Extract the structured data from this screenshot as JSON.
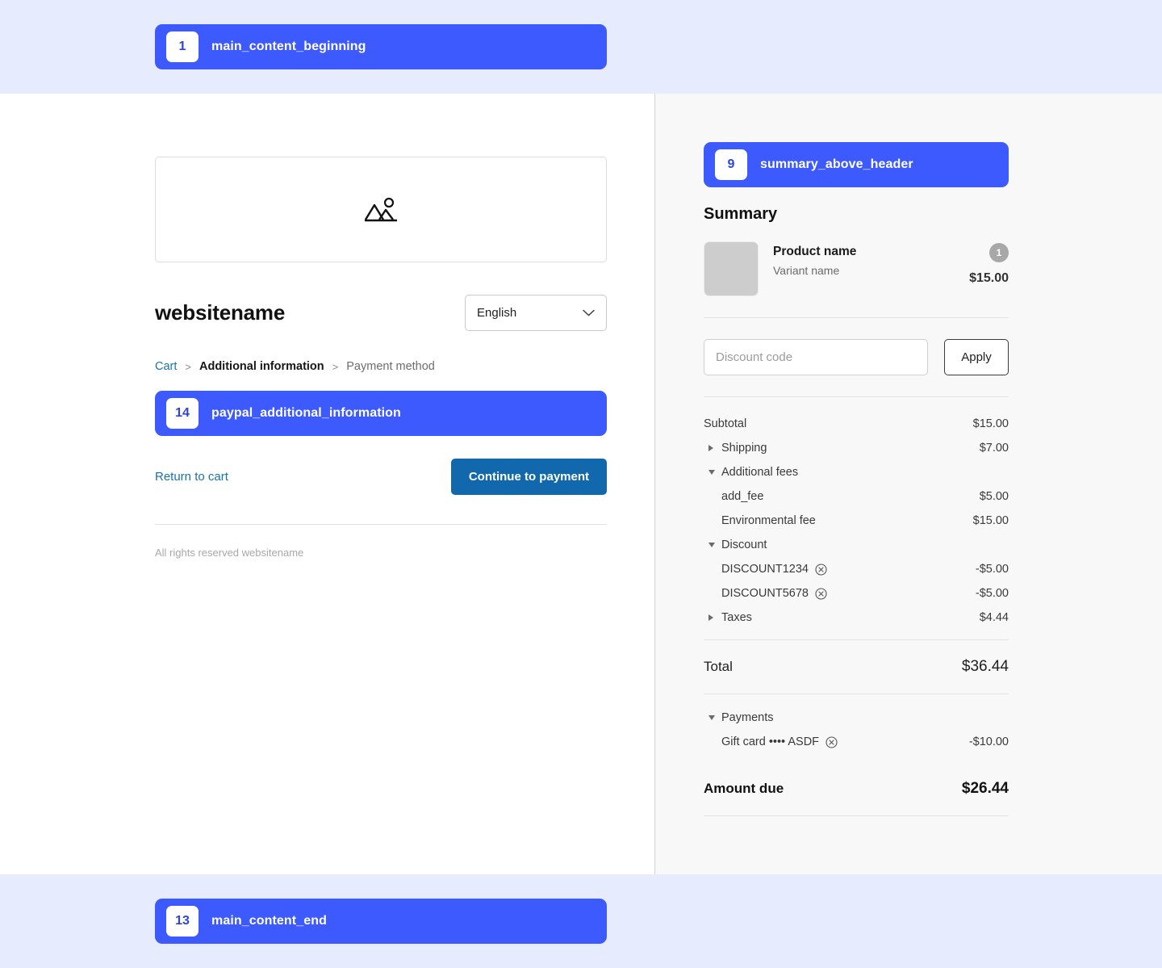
{
  "annotations": {
    "top": {
      "number": "1",
      "label": "main_content_beginning"
    },
    "paypal": {
      "number": "14",
      "label": "paypal_additional_information"
    },
    "bottom": {
      "number": "13",
      "label": "main_content_end"
    },
    "summary": {
      "number": "9",
      "label": "summary_above_header"
    }
  },
  "left": {
    "image_placeholder_icon": "image-placeholder-icon",
    "brand_name": "websitename",
    "language": {
      "value": "English",
      "chevron": "chevron-down-icon"
    },
    "breadcrumb": {
      "cart": "Cart",
      "separator": ">",
      "current": "Additional information",
      "next": "Payment method"
    },
    "return_to_cart": "Return to cart",
    "continue_button": "Continue to payment",
    "footer": "All rights reserved websitename"
  },
  "summary": {
    "title": "Summary",
    "product": {
      "name": "Product name",
      "variant": "Variant name",
      "quantity": "1",
      "price": "$15.00"
    },
    "discount_field": {
      "placeholder": "Discount code",
      "value": "",
      "apply_label": "Apply"
    },
    "lines": [
      {
        "label": "Subtotal",
        "amount": "$15.00",
        "toggle": "none",
        "indent": false,
        "removable": false
      },
      {
        "label": "Shipping",
        "amount": "$7.00",
        "toggle": "collapsed",
        "indent": false,
        "removable": false
      },
      {
        "label": "Additional fees",
        "amount": "",
        "toggle": "expanded",
        "indent": false,
        "removable": false
      },
      {
        "label": "add_fee",
        "amount": "$5.00",
        "toggle": "none",
        "indent": true,
        "removable": false
      },
      {
        "label": "Environmental fee",
        "amount": "$15.00",
        "toggle": "none",
        "indent": true,
        "removable": false
      },
      {
        "label": "Discount",
        "amount": "",
        "toggle": "expanded",
        "indent": false,
        "removable": false
      },
      {
        "label": "DISCOUNT1234",
        "amount": "-$5.00",
        "toggle": "none",
        "indent": true,
        "removable": true
      },
      {
        "label": "DISCOUNT5678",
        "amount": "-$5.00",
        "toggle": "none",
        "indent": true,
        "removable": true
      },
      {
        "label": "Taxes",
        "amount": "$4.44",
        "toggle": "collapsed",
        "indent": false,
        "removable": false
      }
    ],
    "total": {
      "label": "Total",
      "amount": "$36.44"
    },
    "payments": {
      "label": "Payments",
      "toggle": "expanded",
      "items": [
        {
          "label": "Gift card •••• ASDF",
          "amount": "-$10.00",
          "removable": true
        }
      ]
    },
    "amount_due": {
      "label": "Amount due",
      "amount": "$26.44"
    }
  },
  "colors": {
    "annotation_blue": "#3d5afe",
    "band_background": "#e6ebfd",
    "primary_button": "#1168ad",
    "link": "#1773b0",
    "summary_background": "#f8f8f8"
  }
}
